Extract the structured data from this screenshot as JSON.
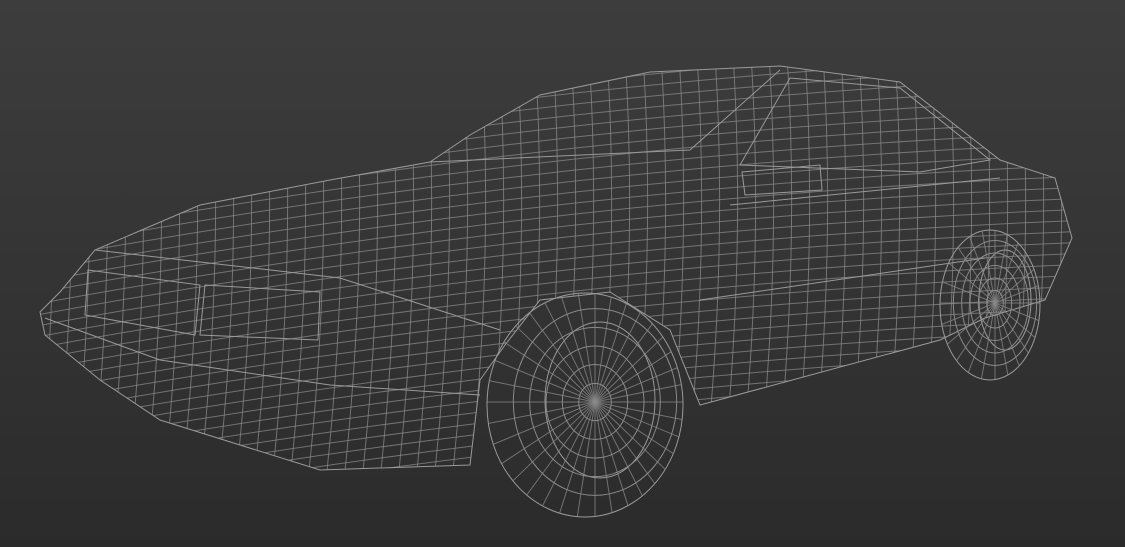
{
  "scene": {
    "subject": "car-wireframe",
    "colors": {
      "background_top": "#3d3d3d",
      "background_bottom": "#2b2b2b",
      "wire": "#8a8a8a",
      "wire_dense": "#9a9a9a"
    }
  }
}
